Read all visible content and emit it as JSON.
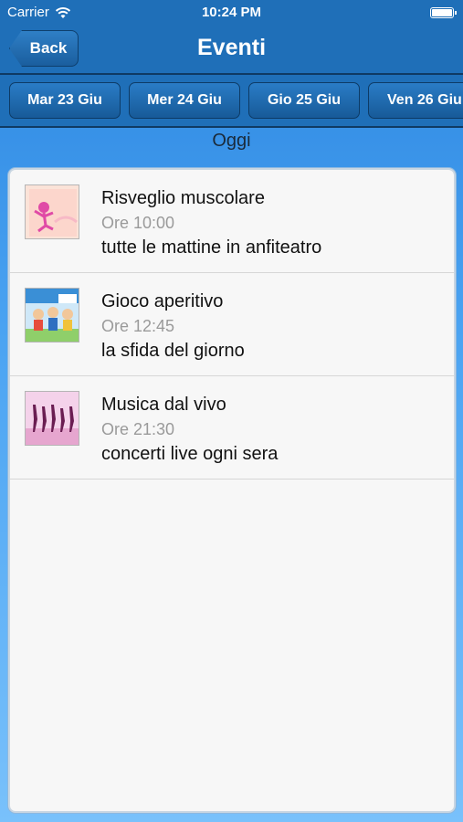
{
  "status_bar": {
    "carrier": "Carrier",
    "time": "10:24 PM"
  },
  "nav": {
    "back_label": "Back",
    "title": "Eventi"
  },
  "date_tabs": [
    {
      "label": "Mar 23 Giu"
    },
    {
      "label": "Mer 24 Giu"
    },
    {
      "label": "Gio 25 Giu"
    },
    {
      "label": "Ven 26 Giu"
    }
  ],
  "section_title": "Oggi",
  "events": [
    {
      "title": "Risveglio muscolare",
      "time": "Ore 10:00",
      "description": "tutte le mattine in anfiteatro",
      "thumb": "stretching-thumbnail"
    },
    {
      "title": "Gioco aperitivo",
      "time": "Ore 12:45",
      "description": "la sfida del giorno",
      "thumb": "children-game-thumbnail"
    },
    {
      "title": "Musica dal vivo",
      "time": "Ore 21:30",
      "description": "concerti live ogni sera",
      "thumb": "dancers-thumbnail"
    }
  ],
  "colors": {
    "bar_blue": "#1f6fb8",
    "background_top": "#2c86e0",
    "background_bottom": "#79c1fb",
    "panel": "#f7f7f7"
  }
}
